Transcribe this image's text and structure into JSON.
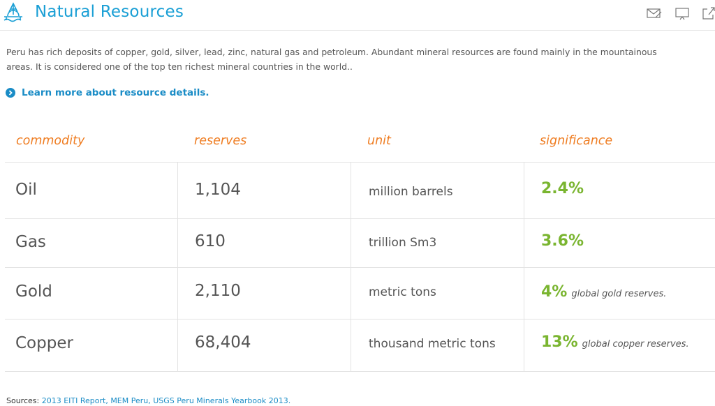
{
  "header": {
    "title": "Natural Resources",
    "icons": [
      "mail-icon",
      "present-icon",
      "share-icon"
    ]
  },
  "intro": {
    "text": "Peru has rich deposits of copper, gold, silver, lead, zinc, natural gas and petroleum. Abundant mineral resources are found mainly in the mountainous areas. It is considered one of the top ten richest mineral countries in the world.."
  },
  "learn_more": {
    "label": "Learn more about resource details."
  },
  "table": {
    "columns": [
      "commodity",
      "reserves",
      "unit",
      "significance"
    ],
    "rows": [
      {
        "commodity": "Oil",
        "reserves": "1,104",
        "unit": "million barrels",
        "significance": "2.4%",
        "note": ""
      },
      {
        "commodity": "Gas",
        "reserves": "610",
        "unit": "trillion Sm3",
        "significance": "3.6%",
        "note": ""
      },
      {
        "commodity": "Gold",
        "reserves": "2,110",
        "unit": "metric tons",
        "significance": "4%",
        "note": "global gold reserves."
      },
      {
        "commodity": "Copper",
        "reserves": "68,404",
        "unit": "thousand metric tons",
        "significance": "13%",
        "note": "global copper reserves."
      }
    ]
  },
  "sources": {
    "label": "Sources:",
    "links": "2013 EITI Report, MEM Peru, USGS Peru Minerals Yearbook 2013."
  },
  "colors": {
    "brand_blue": "#1a9fd5",
    "header_orange": "#ef7d22",
    "significance_green": "#7ab530"
  }
}
